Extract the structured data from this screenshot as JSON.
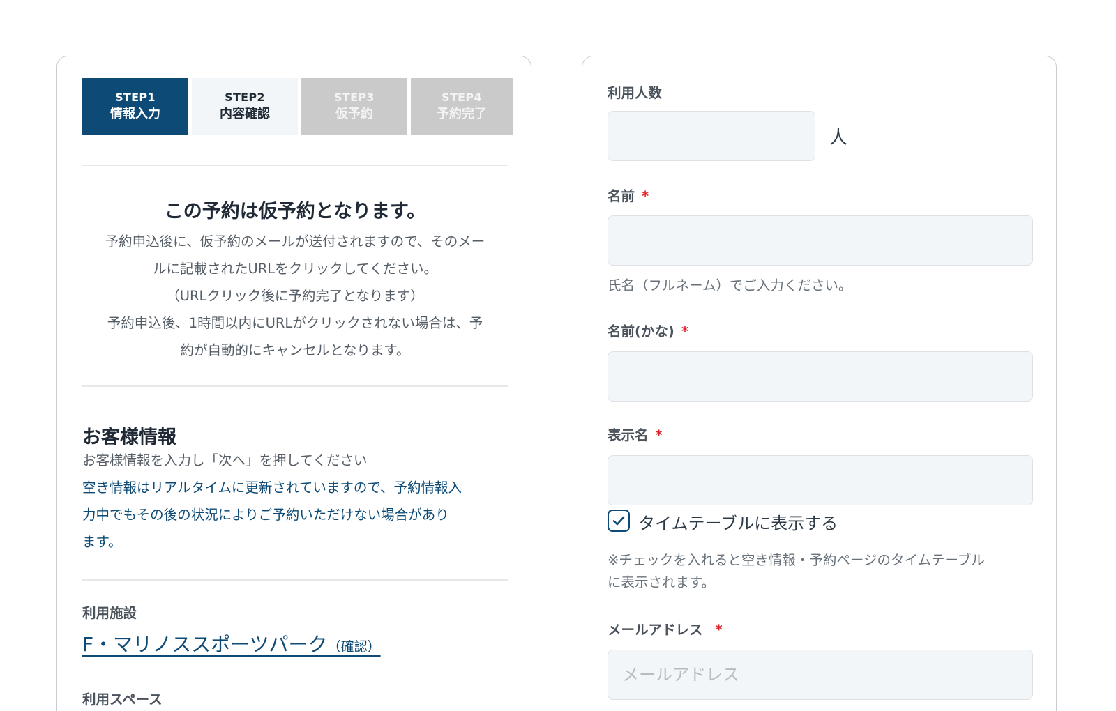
{
  "steps": [
    {
      "num": "STEP1",
      "label": "情報入力"
    },
    {
      "num": "STEP2",
      "label": "内容確認"
    },
    {
      "num": "STEP3",
      "label": "仮予約"
    },
    {
      "num": "STEP4",
      "label": "予約完了"
    }
  ],
  "notice": {
    "title": "この予約は仮予約となります。",
    "lines": [
      "予約申込後に、仮予約のメールが送付されますので、そのメー",
      "ルに記載されたURLをクリックしてください。",
      "（URLクリック後に予約完了となります）",
      "予約申込後、1時間以内にURLがクリックされない場合は、予",
      "約が自動的にキャンセルとなります。"
    ]
  },
  "customer": {
    "title": "お客様情報",
    "instruction": "お客様情報を入力し「次へ」を押してください",
    "warning_lines": [
      "空き情報はリアルタイムに更新されていますので、予約情報入",
      "力中でもその後の状況によりご予約いただけない場合があり",
      "ます。"
    ]
  },
  "facility": {
    "label": "利用施設",
    "name": "F・マリノススポーツパーク",
    "confirm": "（確認）"
  },
  "space": {
    "label": "利用スペース"
  },
  "form": {
    "people": {
      "label": "利用人数",
      "value": "",
      "unit": "人"
    },
    "name": {
      "label": "名前",
      "required_mark": "*",
      "value": "",
      "help": "氏名（フルネーム）でご入力ください。"
    },
    "kana": {
      "label": "名前(かな)",
      "required_mark": "*",
      "value": ""
    },
    "display_name": {
      "label": "表示名",
      "required_mark": "*",
      "value": ""
    },
    "timetable": {
      "label": "タイムテーブルに表示する",
      "checked": true,
      "help_lines": [
        "※チェックを入れると空き情報・予約ページのタイムテーブル",
        "に表示されます。"
      ]
    },
    "email": {
      "label": "メールアドレス",
      "required_mark": "*",
      "value": "",
      "placeholder": "メールアドレス"
    }
  },
  "colors": {
    "primary": "#0d4a75",
    "required": "#e0242c",
    "step_inactive": "#cacaca",
    "input_bg": "#f3f6f9"
  }
}
